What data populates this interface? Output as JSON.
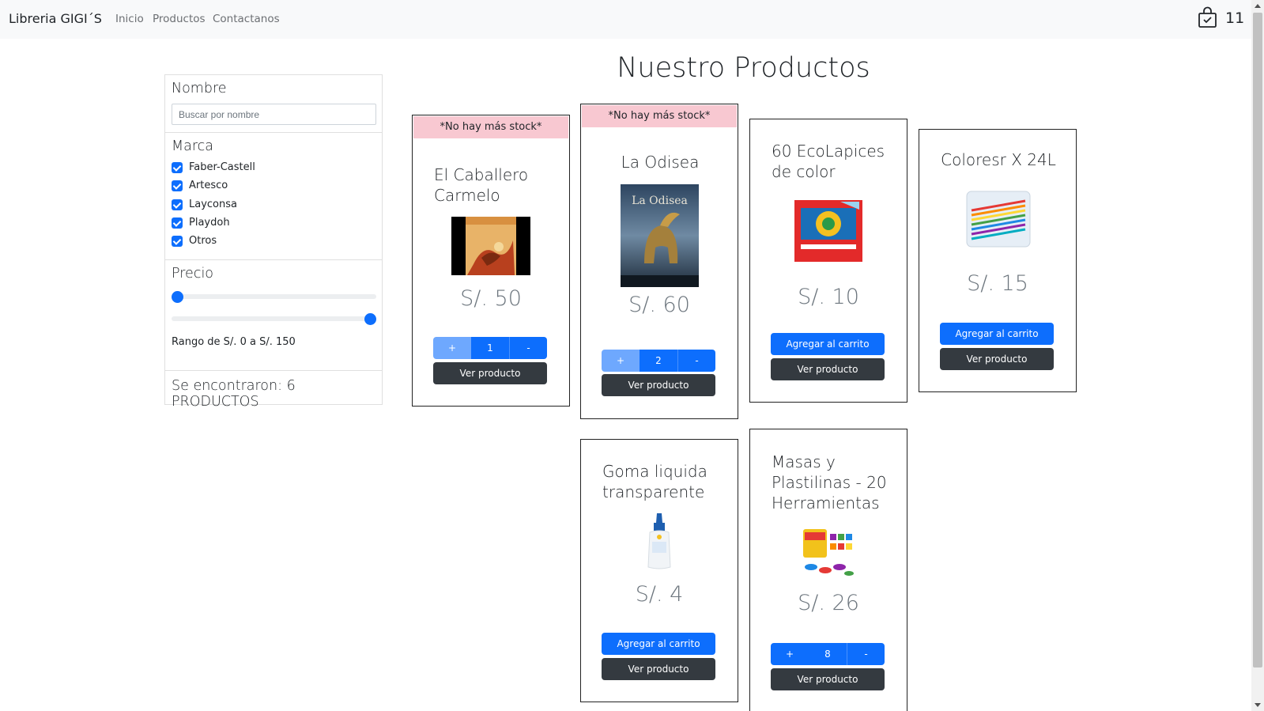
{
  "navbar": {
    "brand": "Libreria GIGI´S",
    "links": [
      "Inicio",
      "Productos",
      "Contactanos"
    ],
    "cart_count": "11"
  },
  "page": {
    "title": "Nuestro Productos"
  },
  "filters": {
    "name_heading": "Nombre",
    "search_placeholder": "Buscar por nombre",
    "brand_heading": "Marca",
    "brands": [
      {
        "label": "Faber-Castell",
        "checked": true
      },
      {
        "label": "Artesco",
        "checked": true
      },
      {
        "label": "Layconsa",
        "checked": true
      },
      {
        "label": "Playdoh",
        "checked": true
      },
      {
        "label": "Otros",
        "checked": true
      }
    ],
    "price_heading": "Precio",
    "range_min_fraction": 0,
    "range_max_fraction": 1,
    "range_text": "Rango de S/. 0 a S/. 150",
    "results_text": "Se encontraron: 6 PRODUCTOS"
  },
  "products": [
    {
      "name": "El Caballero Carmelo",
      "price": "S/. 50",
      "stock_banner": "*No hay más stock*",
      "quantity": "1",
      "plus": "+",
      "minus": "-",
      "view_label": "Ver producto"
    },
    {
      "name": "La Odisea",
      "price": "S/. 60",
      "stock_banner": "*No hay más stock*",
      "quantity": "2",
      "plus": "+",
      "minus": "-",
      "view_label": "Ver producto",
      "image_text": "La Odisea"
    },
    {
      "name": "60 EcoLapices de color",
      "price": "S/. 10",
      "add_label": "Agregar al carrito",
      "view_label": "Ver producto"
    },
    {
      "name": "Coloresr X 24L",
      "price": "S/. 15",
      "add_label": "Agregar al carrito",
      "view_label": "Ver producto"
    },
    {
      "name": "Goma liquida transparente",
      "price": "S/. 4",
      "add_label": "Agregar al carrito",
      "view_label": "Ver producto"
    },
    {
      "name": "Masas y Plastilinas - 20 Herramientas",
      "price": "S/. 26",
      "quantity": "8",
      "plus": "+",
      "minus": "-",
      "view_label": "Ver producto"
    }
  ],
  "colors": {
    "primary": "#0d6efd",
    "dark": "#343a40",
    "stock_banner": "#f8c8d1",
    "navbar": "#f8f9fa"
  }
}
